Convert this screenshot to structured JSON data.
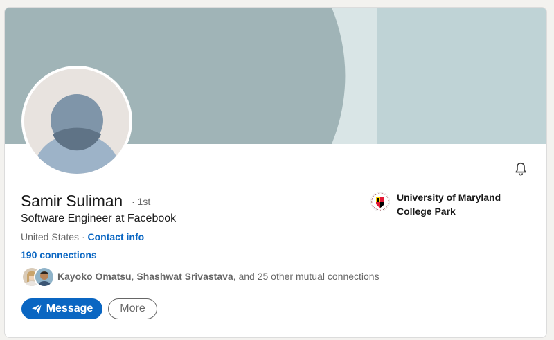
{
  "profile": {
    "name": "Samir Suliman",
    "degree": "· 1st",
    "headline": "Software Engineer at Facebook",
    "location": "United States",
    "separator": "·",
    "contact_info_label": "Contact info",
    "connections_label": "190 connections",
    "mutual": {
      "name1": "Kayoko Omatsu",
      "comma": ",",
      "name2": "Shashwat Srivastava",
      "rest": ", and 25 other mutual connections"
    }
  },
  "education": {
    "school": "University of Maryland College Park"
  },
  "actions": {
    "message_label": "Message",
    "more_label": "More"
  },
  "icons": {
    "notifications": "bell-icon",
    "message": "send-icon"
  },
  "colors": {
    "accent": "#0a66c2",
    "banner_dark": "#a0b4b7",
    "banner_light": "#bfd3d6",
    "banner_mid": "#d9e5e6"
  }
}
